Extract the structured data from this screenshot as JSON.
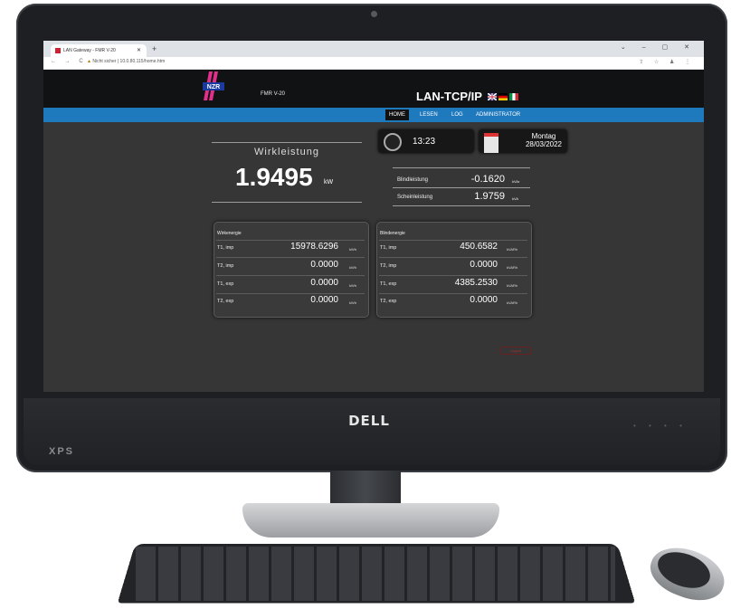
{
  "browser": {
    "tab_title": "LAN Gateway - FMR V-20",
    "url_warning": "Nicht sicher",
    "url": "10.0.80.115/home.htm"
  },
  "hardware": {
    "brand": "DELL",
    "model": "XPS"
  },
  "app": {
    "logo_text": "NZR",
    "model": "FMR V-20",
    "title": "LAN-TCP/IP",
    "nav": [
      "HOME",
      "LESEN",
      "LOG",
      "ADMINISTRATOR"
    ],
    "flags": [
      "uk-flag-icon",
      "german-flag-icon",
      "italian-flag-icon"
    ]
  },
  "wirkleistung": {
    "label": "Wirkleistung",
    "value": "1.9495",
    "unit": "kW"
  },
  "clock": {
    "time": "13:23",
    "day": "Montag",
    "date": "28/03/2022"
  },
  "secondary": [
    {
      "label": "Blindleistung",
      "value": "-0.1620",
      "unit": "kVAr"
    },
    {
      "label": "Scheinleistung",
      "value": "1.9759",
      "unit": "kVA"
    }
  ],
  "wirkenergie": {
    "title": "Wirkenergie",
    "rows": [
      {
        "label": "T1, imp",
        "value": "15978.6296",
        "unit": "kWh"
      },
      {
        "label": "T2, imp",
        "value": "0.0000",
        "unit": "kWh"
      },
      {
        "label": "T1, exp",
        "value": "0.0000",
        "unit": "kWh"
      },
      {
        "label": "T2, exp",
        "value": "0.0000",
        "unit": "kWh"
      }
    ]
  },
  "blindenergie": {
    "title": "Blindenergie",
    "rows": [
      {
        "label": "T1, imp",
        "value": "450.6582",
        "unit": "kVARh"
      },
      {
        "label": "T2, imp",
        "value": "0.0000",
        "unit": "kVARh"
      },
      {
        "label": "T1, exp",
        "value": "4385.2530",
        "unit": "kVARh"
      },
      {
        "label": "T2, exp",
        "value": "0.0000",
        "unit": "kVARh"
      }
    ]
  },
  "logout_label": "Logout",
  "colors": {
    "navbar": "#1f79bd",
    "header": "#111213",
    "content": "#363636"
  }
}
